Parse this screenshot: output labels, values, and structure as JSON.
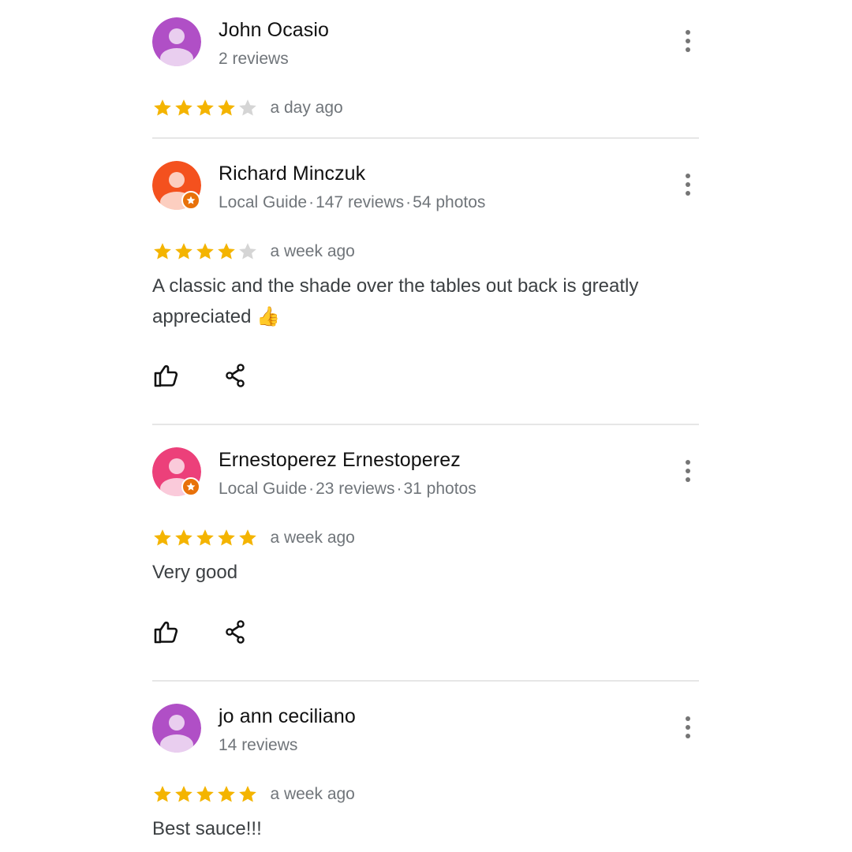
{
  "colors": {
    "star_filled": "#f4b400",
    "star_empty": "#d5d5d5",
    "secondary_text": "#70757a",
    "divider": "#e6e6e6",
    "local_guide_badge": "#e8710a"
  },
  "reviews": [
    {
      "name": "John Ocasio",
      "avatar_color": "#b04fc6",
      "avatar_icon": "person-icon",
      "local_guide": false,
      "meta": {
        "reviews": "2 reviews"
      },
      "rating": 4,
      "time": "a day ago",
      "text": "",
      "show_actions": false
    },
    {
      "name": "Richard Minczuk",
      "avatar_color": "#f4511e",
      "avatar_icon": "person-icon",
      "local_guide": true,
      "meta": {
        "guide": "Local Guide",
        "reviews": "147 reviews",
        "photos": "54 photos"
      },
      "rating": 4,
      "time": "a week ago",
      "text": "A classic and the shade over the tables out back is greatly appreciated",
      "emoji": "👍",
      "show_actions": true
    },
    {
      "name": "Ernestoperez Ernestoperez",
      "avatar_color": "#ec407a",
      "avatar_icon": "person-icon",
      "local_guide": true,
      "meta": {
        "guide": "Local Guide",
        "reviews": "23 reviews",
        "photos": "31 photos"
      },
      "rating": 5,
      "time": "a week ago",
      "text": "Very good",
      "show_actions": true
    },
    {
      "name": "jo ann ceciliano",
      "avatar_color": "#b04fc6",
      "avatar_icon": "person-icon",
      "local_guide": false,
      "meta": {
        "reviews": "14 reviews"
      },
      "rating": 5,
      "time": "a week ago",
      "text": "Best sauce!!!",
      "show_actions": false
    }
  ]
}
